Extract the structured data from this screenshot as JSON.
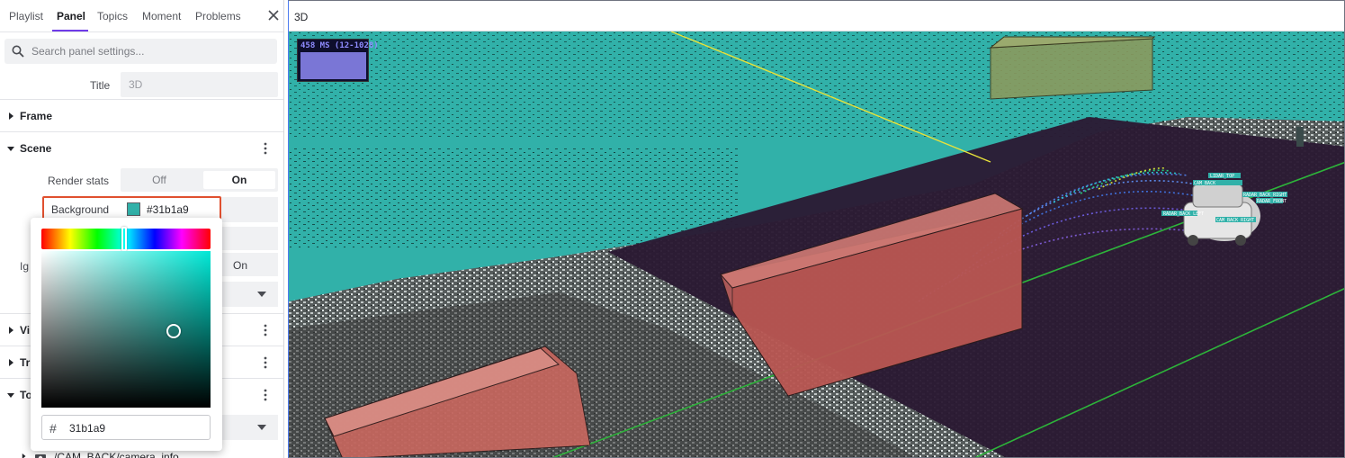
{
  "sidebar": {
    "tabs": [
      {
        "label": "Playlist"
      },
      {
        "label": "Panel"
      },
      {
        "label": "Topics"
      },
      {
        "label": "Moment"
      },
      {
        "label": "Problems"
      }
    ],
    "active_tab": "Panel",
    "search": {
      "placeholder": "Search panel settings..."
    },
    "title_field": {
      "label": "Title",
      "value": "3D"
    },
    "sections": {
      "frame": "Frame",
      "scene": "Scene",
      "view_partial": "Vi",
      "transforms_partial": "Tr",
      "topics_partial": "To"
    },
    "scene": {
      "render_stats": {
        "label": "Render stats",
        "options": [
          "Off",
          "On"
        ],
        "selected": "On"
      },
      "background": {
        "label": "Background",
        "value": "#31b1a9",
        "color": "#31b1a9"
      },
      "ignore_partial": {
        "label": "Ig",
        "value": "On"
      }
    },
    "topic_item_partial": "/CAM_BACK/camera_info"
  },
  "color_picker": {
    "hex_value": "31b1a9",
    "hash": "#"
  },
  "viewport": {
    "title": "3D",
    "render_stats_label": "458 MS (12-1028)",
    "background_color": "#31b1a9",
    "labels": [
      "RADAR_BACK_RIGHT",
      "RADAR_FRONT",
      "CAM_BACK",
      "CAM_BACK_RIGHT",
      "RADAR_BACK_LEFT",
      "LIDAR_TOP"
    ]
  }
}
